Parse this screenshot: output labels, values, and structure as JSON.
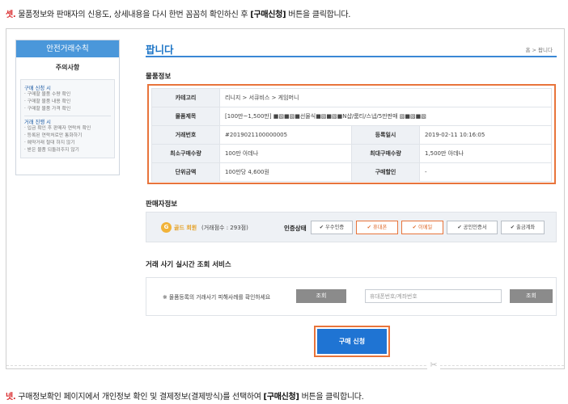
{
  "step3": {
    "num": "셋.",
    "pre": " 물품정보와 판매자의 신용도, 상세내용을 다시 한번 꼼꼼히 확인하신 후 ",
    "bold": "[구매신청]",
    "post": " 버튼을 클릭합니다."
  },
  "step4": {
    "num": "넷.",
    "pre": " 구매정보확인 페이지에서 개인정보 확인 및 결제정보(결제방식)를 선택하여 ",
    "bold": "[구매신청]",
    "post": " 버튼을 클릭합니다."
  },
  "sidebar": {
    "header": "안전거래수칙",
    "subtitle": "주의사항",
    "sections": [
      {
        "title": "구매 신청 시",
        "items": [
          "· 구매할 물품 수량 확인",
          "· 구매할 물품 내용 확인",
          "· 구매할 물품 가격 확인"
        ]
      },
      {
        "title": "거래 진행 시",
        "items": [
          "· 입금 확인 후 판매자 연락처 확인",
          "· 등록된 연락처로만 통화하기",
          "· 예약거래 절대 하지 않기",
          "· 받은 물품 되돌려주지 않기"
        ]
      }
    ]
  },
  "main": {
    "title": "팝니다",
    "breadcrumb": "홈 > 팝니다"
  },
  "product": {
    "section_title": "물품정보",
    "category_label": "카테고리",
    "category": "리니지 > 서큐비스 > 게임머니",
    "name_label": "물품제목",
    "name": "[100만~1,500만] ■▧■▧■선물식■▧■▧■N샵/룸티/스냅/5만판매 ▧■▧■▧",
    "number_label": "거래번호",
    "number": "#2019021100000005",
    "date_label": "등록일시",
    "date": "2019-02-11 10:16:05",
    "min_label": "최소구매수량",
    "min": "100만 아데나",
    "max_label": "최대구매수량",
    "max": "1,500만 아데나",
    "unit_label": "단위금액",
    "unit": "100만당 4,600원",
    "discount_label": "구매할인",
    "discount": "-"
  },
  "seller": {
    "section_title": "판매자정보",
    "badge": "G",
    "grade": "골드 회원",
    "score": "(거래점수 : 293점)",
    "auth_label": "인증상태",
    "auth": [
      {
        "label": "우수인증",
        "on": false
      },
      {
        "label": "휴대폰",
        "on": true
      },
      {
        "label": "이메일",
        "on": true
      },
      {
        "label": "공인인증서",
        "on": false
      },
      {
        "label": "출금계좌",
        "on": false
      }
    ],
    "check": "✔"
  },
  "fraud": {
    "section_title": "거래 사기 실시간 조회 서비스",
    "text": "※ 물품등록의 거래사기 피해사례를 확인하세요",
    "btn1": "조회",
    "input_placeholder": "휴대폰번호/계좌번호",
    "btn2": "조회"
  },
  "purchase": {
    "label": "구매 신청"
  },
  "icons": {
    "scissors": "✂"
  },
  "colors": {
    "accent": "#1f74d3",
    "highlight": "#e8743b",
    "gold": "#f1b339",
    "step_num": "#d9292b"
  }
}
